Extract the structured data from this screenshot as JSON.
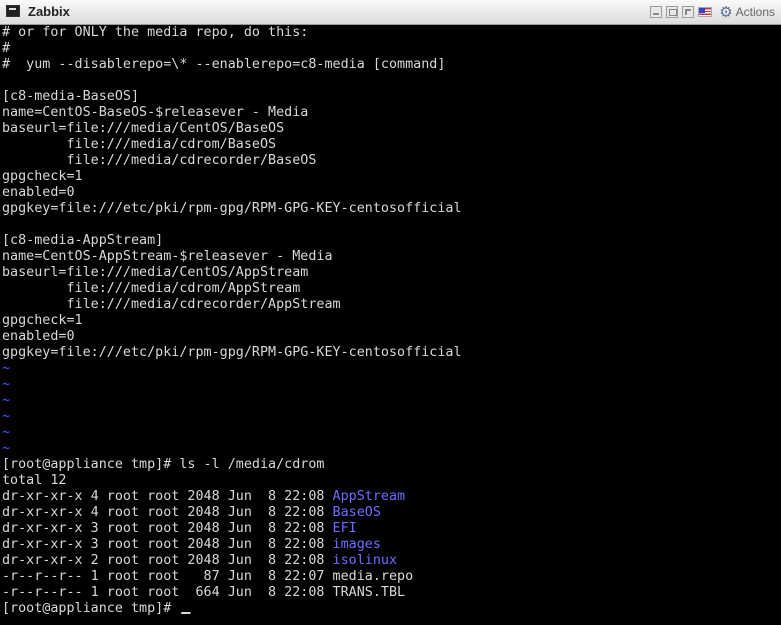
{
  "window": {
    "title": "Zabbix",
    "actions_label": "Actions",
    "icons": [
      "app-icon",
      "minimize-icon",
      "restore-icon",
      "fullscreen-icon",
      "keyboard-layout-flag-icon",
      "gear-icon"
    ]
  },
  "terminal": {
    "lines": [
      "# or for ONLY the media repo, do this:",
      "#",
      "#  yum --disablerepo=\\* --enablerepo=c8-media [command]",
      "",
      "[c8-media-BaseOS]",
      "name=CentOS-BaseOS-$releasever - Media",
      "baseurl=file:///media/CentOS/BaseOS",
      "        file:///media/cdrom/BaseOS",
      "        file:///media/cdrecorder/BaseOS",
      "gpgcheck=1",
      "enabled=0",
      "gpgkey=file:///etc/pki/rpm-gpg/RPM-GPG-KEY-centosofficial",
      "",
      "[c8-media-AppStream]",
      "name=CentOS-AppStream-$releasever - Media",
      "baseurl=file:///media/CentOS/AppStream",
      "        file:///media/cdrom/AppStream",
      "        file:///media/cdrecorder/AppStream",
      "gpgcheck=1",
      "enabled=0",
      "gpgkey=file:///etc/pki/rpm-gpg/RPM-GPG-KEY-centosofficial",
      "~",
      "~",
      "~",
      "~",
      "~",
      "~",
      "[root@appliance tmp]# ls -l /media/cdrom",
      "total 12"
    ],
    "listing": [
      {
        "meta": "dr-xr-xr-x 4 root root 2048 Jun  8 22:08 ",
        "name": "AppStream"
      },
      {
        "meta": "dr-xr-xr-x 4 root root 2048 Jun  8 22:08 ",
        "name": "BaseOS"
      },
      {
        "meta": "dr-xr-xr-x 3 root root 2048 Jun  8 22:08 ",
        "name": "EFI"
      },
      {
        "meta": "dr-xr-xr-x 3 root root 2048 Jun  8 22:08 ",
        "name": "images"
      },
      {
        "meta": "dr-xr-xr-x 2 root root 2048 Jun  8 22:08 ",
        "name": "isolinux"
      },
      {
        "meta": "-r--r--r-- 1 root root   87 Jun  8 22:07 ",
        "name": "media.repo"
      },
      {
        "meta": "-r--r--r-- 1 root root  664 Jun  8 22:08 ",
        "name": "TRANS.TBL"
      }
    ],
    "prompt": "[root@appliance tmp]# ",
    "colors": {
      "background": "#000000",
      "text": "#d8d8d8",
      "directory": "#6f6cff",
      "tilde": "#4a58ff"
    }
  }
}
